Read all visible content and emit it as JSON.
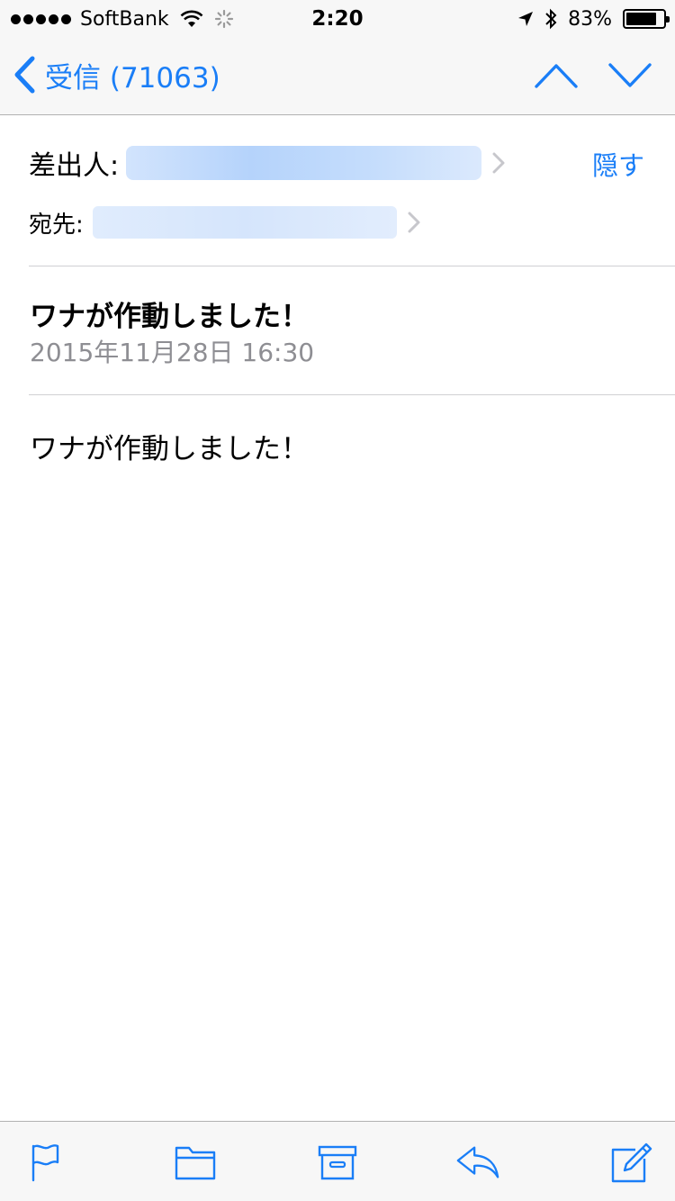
{
  "status_bar": {
    "carrier": "SoftBank",
    "time": "2:20",
    "battery_percent": "83%",
    "battery_level": 0.83
  },
  "nav": {
    "back_label": "受信 (71063)",
    "accent_color": "#1a7ef7"
  },
  "header": {
    "from_label": "差出人:",
    "to_label": "宛先:",
    "hide_label": "隠す"
  },
  "message": {
    "subject": "ワナが作動しました！",
    "date": "2015年11月28日 16:30",
    "body": "ワナが作動しました！"
  },
  "toolbar": {
    "icons": [
      "flag-icon",
      "folder-icon",
      "archive-icon",
      "reply-icon",
      "compose-icon"
    ]
  }
}
